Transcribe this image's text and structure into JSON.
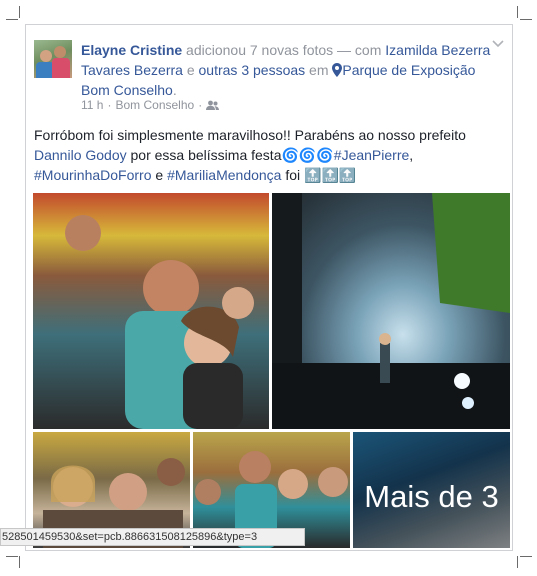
{
  "post": {
    "author": "Elayne Cristine",
    "action": "adicionou 7 novas fotos — com",
    "tagged_person": "Izamilda Bezerra Tavares Bezerra",
    "conjunction": "e",
    "others": "outras 3 pessoas",
    "location_prefix": "em",
    "location": "Parque de Exposição Bom Conselho",
    "location_suffix": ".",
    "time": "11 h",
    "separator1": "·",
    "place_short": "Bom Conselho",
    "separator2": "·",
    "text_part1": "Forróbom foi simplesmente maravilhoso!! Parabéns ao nosso prefeito",
    "mention": "Dannilo Godoy",
    "text_part2": "por essa belíssima festa",
    "emoji1": "🌀🌀🌀",
    "hashtag1": "#JeanPierre",
    "comma": ",",
    "hashtag2": "#MourinhaDoForro",
    "and": "e",
    "hashtag3": "#MariliaMendonça",
    "text_part3": "foi",
    "emoji2": "🔝🔝🔝"
  },
  "photos": {
    "more_label": "Mais de 3"
  },
  "status_bar": {
    "url": "528501459530&set=pcb.886631508125896&type=3"
  },
  "icons": [
    "menu-chevron-icon",
    "location-pin-icon",
    "audience-friends-icon"
  ],
  "colors": {
    "link": "#365899",
    "meta": "#90949c",
    "text": "#1d2129"
  }
}
